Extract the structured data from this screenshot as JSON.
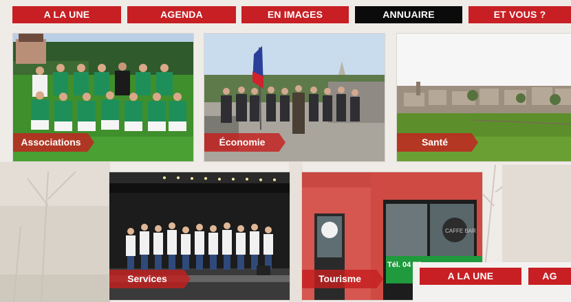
{
  "colors": {
    "tab_red": "#c71f24",
    "tab_active": "#0b0b0b",
    "label_red": "#c42020"
  },
  "nav": {
    "tabs": [
      {
        "label": "A LA UNE",
        "active": false
      },
      {
        "label": "AGENDA",
        "active": false
      },
      {
        "label": "EN IMAGES",
        "active": false
      },
      {
        "label": "ANNUAIRE",
        "active": true
      },
      {
        "label": "ET VOUS ?",
        "active": false
      }
    ]
  },
  "tiles": [
    {
      "label": "Associations",
      "photo": "football-team"
    },
    {
      "label": "Économie",
      "photo": "ceremony-flag"
    },
    {
      "label": "Santé",
      "photo": "village-landscape"
    },
    {
      "label": "Services",
      "photo": "children-stage"
    },
    {
      "label": "Tourisme",
      "photo": "shop-front"
    }
  ],
  "shop": {
    "sign_text": "CAFFE BAR",
    "phone_text": "Tél. 04 75"
  },
  "mini_menu": {
    "tabs": [
      "A LA UNE",
      "AG"
    ]
  }
}
